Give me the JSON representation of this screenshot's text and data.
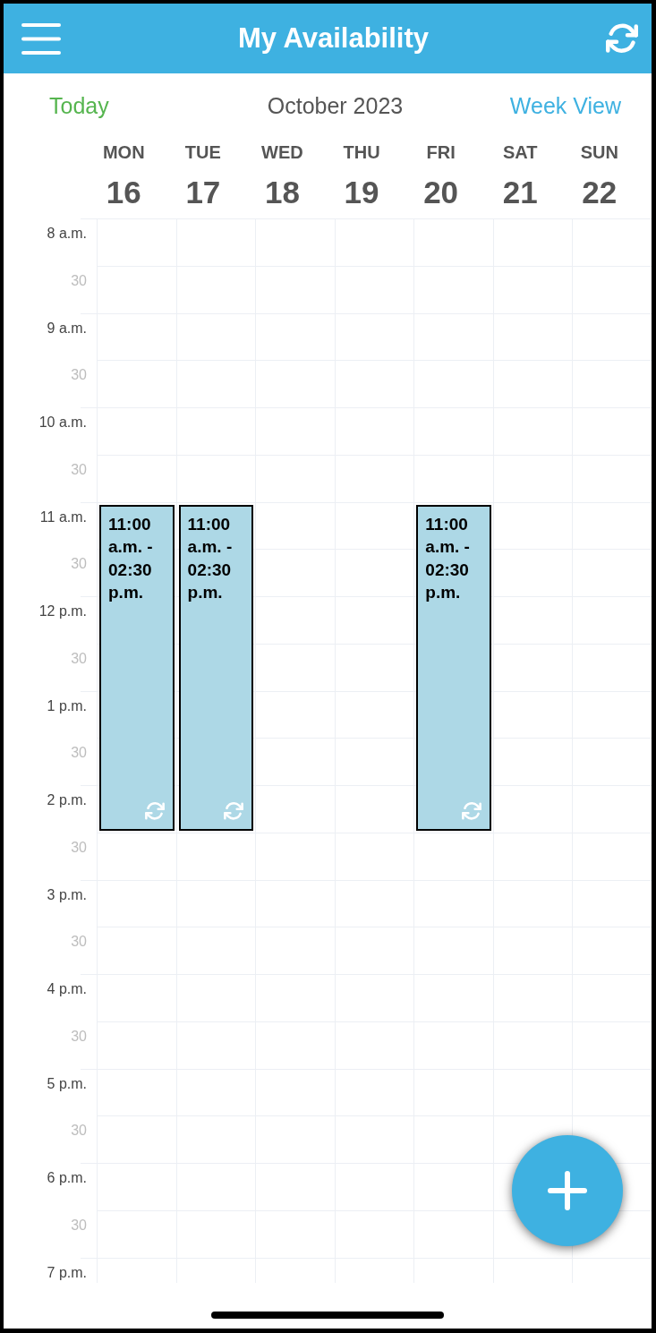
{
  "header": {
    "title": "My Availability"
  },
  "nav": {
    "today": "Today",
    "month": "October 2023",
    "view": "Week View"
  },
  "days": [
    {
      "weekday": "MON",
      "date": "16",
      "events": [
        {
          "time": "11:00 a.m. - 02:30 p.m.",
          "recurring": true
        }
      ]
    },
    {
      "weekday": "TUE",
      "date": "17",
      "events": [
        {
          "time": "11:00 a.m. - 02:30 p.m.",
          "recurring": true
        }
      ]
    },
    {
      "weekday": "WED",
      "date": "18"
    },
    {
      "weekday": "THU",
      "date": "19"
    },
    {
      "weekday": "FRI",
      "date": "20",
      "events": [
        {
          "time": "11:00 a.m. - 02:30 p.m.",
          "recurring": true
        }
      ]
    },
    {
      "weekday": "SAT",
      "date": "21"
    },
    {
      "weekday": "SUN",
      "date": "22"
    }
  ],
  "time_labels": [
    {
      "label": "8 a.m.",
      "kind": "hour"
    },
    {
      "label": "30",
      "kind": "half"
    },
    {
      "label": "9 a.m.",
      "kind": "hour"
    },
    {
      "label": "30",
      "kind": "half"
    },
    {
      "label": "10 a.m.",
      "kind": "hour"
    },
    {
      "label": "30",
      "kind": "half"
    },
    {
      "label": "11 a.m.",
      "kind": "hour"
    },
    {
      "label": "30",
      "kind": "half"
    },
    {
      "label": "12 p.m.",
      "kind": "hour"
    },
    {
      "label": "30",
      "kind": "half"
    },
    {
      "label": "1 p.m.",
      "kind": "hour"
    },
    {
      "label": "30",
      "kind": "half"
    },
    {
      "label": "2 p.m.",
      "kind": "hour"
    },
    {
      "label": "30",
      "kind": "half"
    },
    {
      "label": "3 p.m.",
      "kind": "hour"
    },
    {
      "label": "30",
      "kind": "half"
    },
    {
      "label": "4 p.m.",
      "kind": "hour"
    },
    {
      "label": "30",
      "kind": "half"
    },
    {
      "label": "5 p.m.",
      "kind": "hour"
    },
    {
      "label": "30",
      "kind": "half"
    },
    {
      "label": "6 p.m.",
      "kind": "hour"
    },
    {
      "label": "30",
      "kind": "half"
    },
    {
      "label": "7 p.m.",
      "kind": "hour"
    }
  ]
}
